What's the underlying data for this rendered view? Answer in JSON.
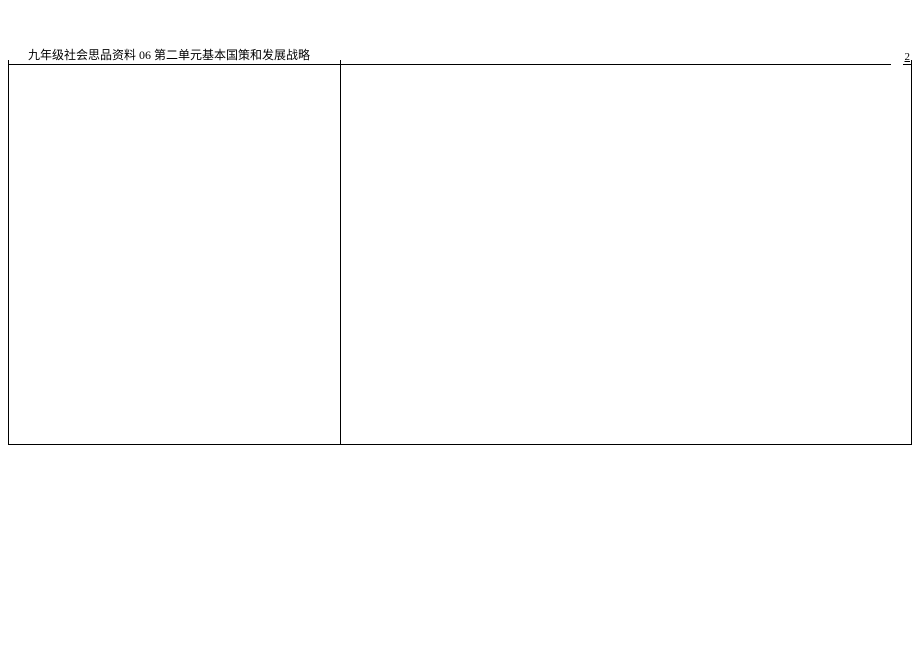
{
  "header": {
    "title": "九年级社会思品资料 06  第二单元基本国策和发展战略",
    "page_number": "2"
  }
}
